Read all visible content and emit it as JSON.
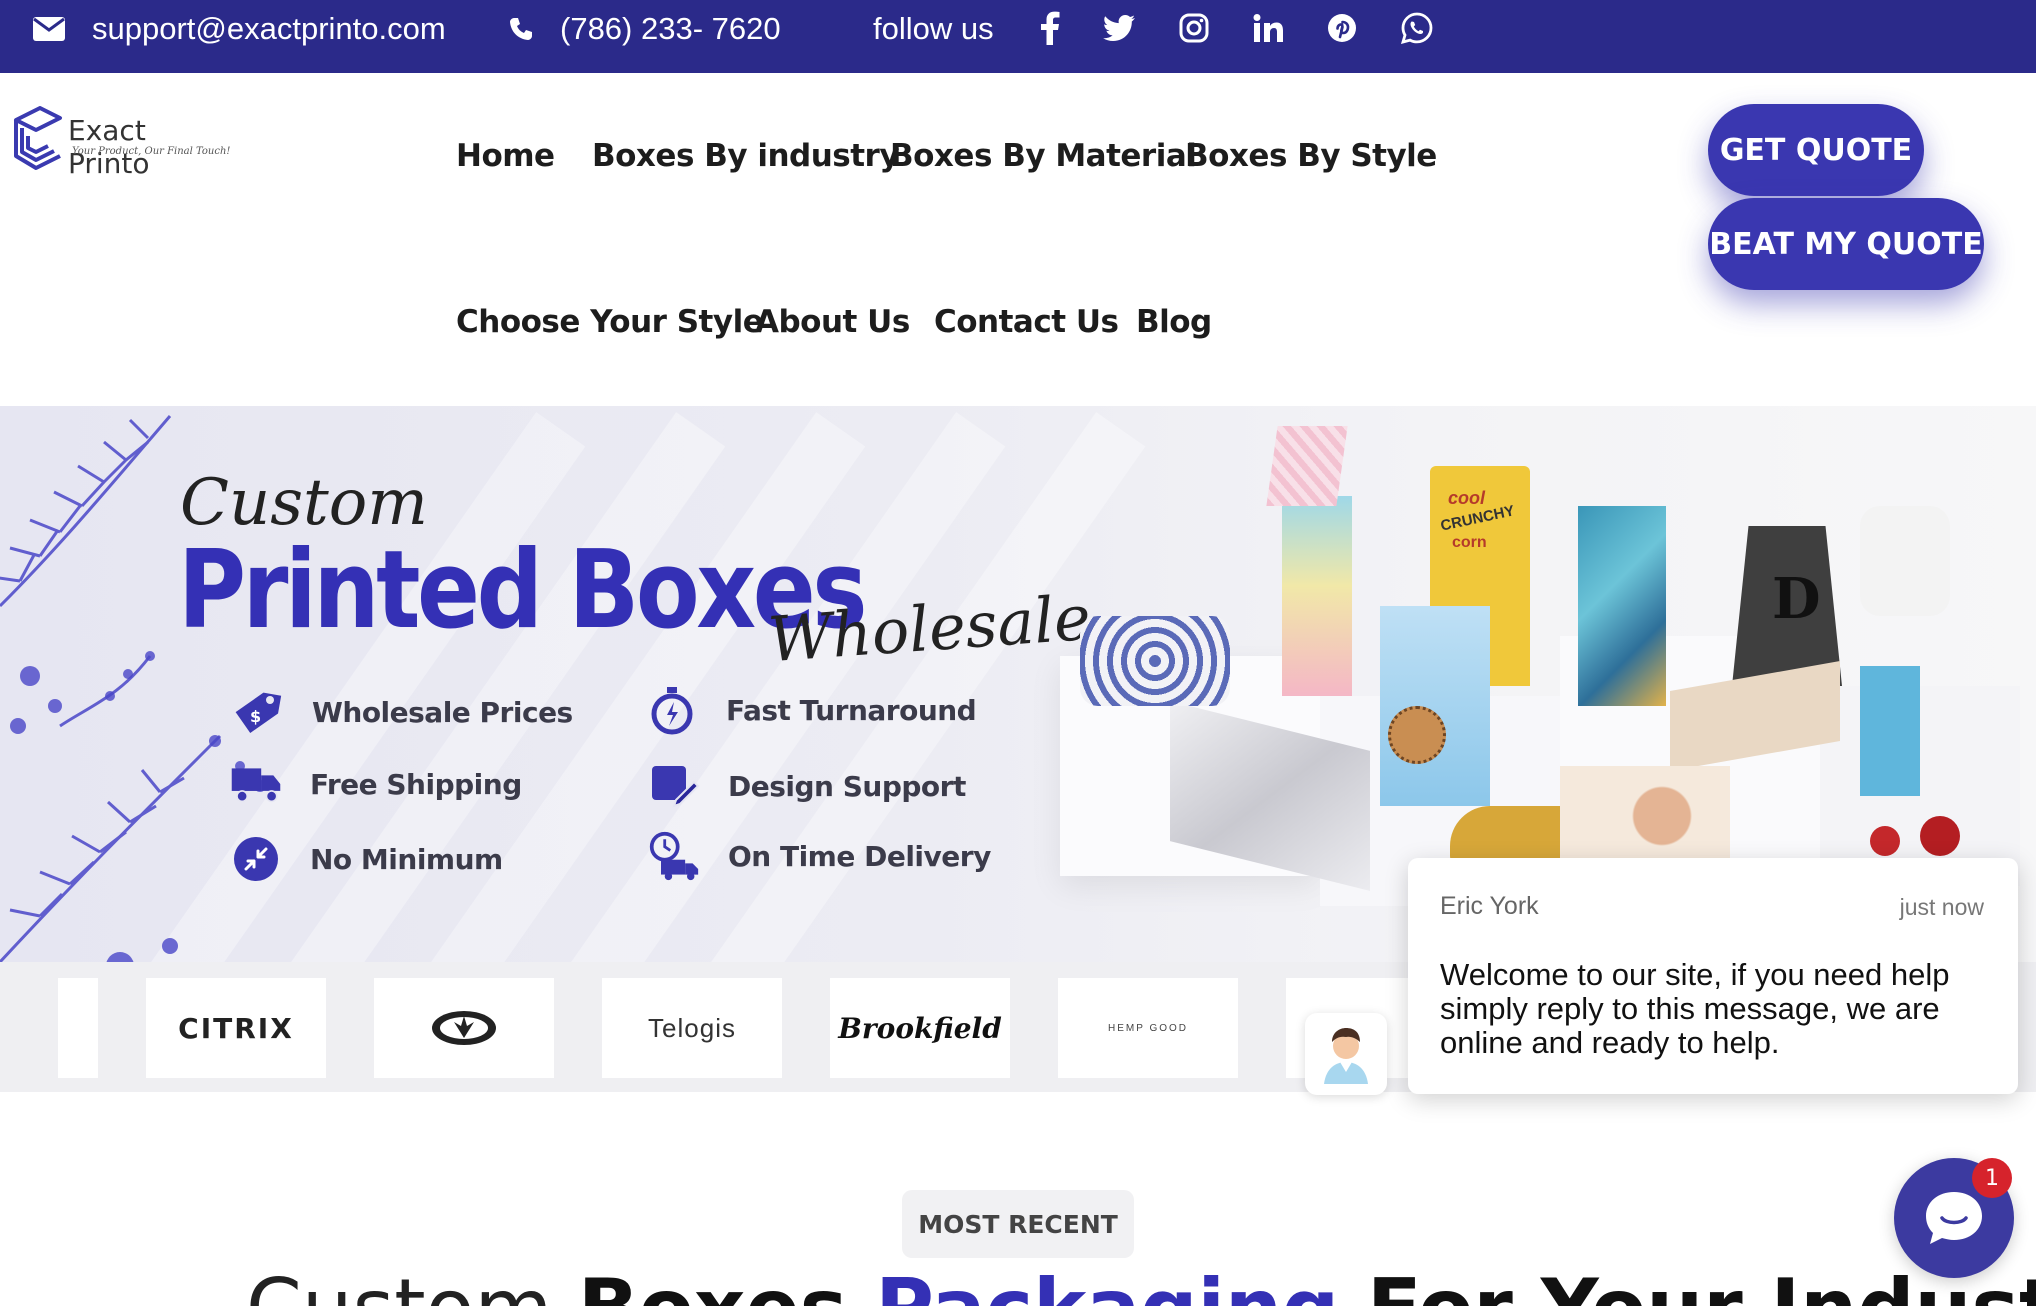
{
  "topbar": {
    "email": "support@exactprinto.com",
    "phone": "(786) 233- 7620",
    "follow": "follow us",
    "social_icons": [
      "facebook-icon",
      "twitter-icon",
      "instagram-icon",
      "linkedin-icon",
      "pinterest-icon",
      "whatsapp-icon"
    ]
  },
  "logo": {
    "name": "Exact Printo",
    "tagline": "Your Product, Our Final Touch!"
  },
  "nav": {
    "home": "Home",
    "industry": "Boxes By industry",
    "material": "Boxes By Material",
    "style": "Boxes By Style",
    "choose": "Choose Your Style",
    "about": "About Us",
    "contact": "Contact Us",
    "blog": "Blog"
  },
  "cta": {
    "get_quote": "GET QUOTE",
    "beat_quote": "BEAT MY QUOTE"
  },
  "hero": {
    "script_top": "Custom",
    "title": "Printed Boxes",
    "script_bottom": "Wholesale",
    "features": [
      {
        "label": "Wholesale Prices",
        "icon": "price-tag-icon"
      },
      {
        "label": "Fast Turnaround",
        "icon": "stopwatch-icon"
      },
      {
        "label": "Free Shipping",
        "icon": "truck-icon"
      },
      {
        "label": "Design Support",
        "icon": "design-pen-icon"
      },
      {
        "label": "No Minimum",
        "icon": "arrows-icon"
      },
      {
        "label": "On Time Delivery",
        "icon": "delivery-clock-icon"
      }
    ],
    "packaging_text": {
      "corn_top": "cool",
      "corn_mid": "CRUNCHY",
      "corn_bottom": "corn",
      "bag_letter": "D"
    }
  },
  "brands": [
    "CITRIX",
    "Telogis",
    "Brookfield",
    "HEMP GOOD"
  ],
  "chat": {
    "agent": "Eric York",
    "time": "just now",
    "message": "Welcome to our site, if you need help simply reply to this message, we are online and ready to help.",
    "unread": "1"
  },
  "section": {
    "badge": "MOST RECENT",
    "heading_light": "Custom ",
    "heading_bold": "Boxes ",
    "heading_accent": "Packaging",
    "heading_end": " For Your Industry"
  },
  "colors": {
    "brand": "#2b2a8a",
    "accent": "#3a37b0",
    "badge": "#d6232c"
  }
}
